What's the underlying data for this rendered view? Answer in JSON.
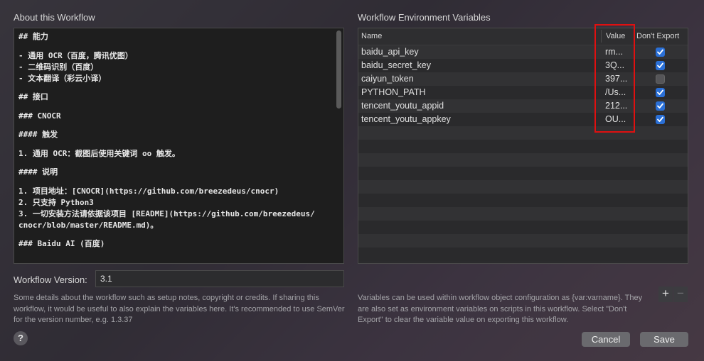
{
  "about": {
    "title": "About this Workflow",
    "notes_lines": [
      "## 能力",
      "",
      "- 通用 OCR（百度，腾讯优图）",
      "- 二维码识别（百度）",
      "- 文本翻译（彩云小译）",
      "",
      "## 接口",
      "",
      "### CNOCR",
      "",
      "#### 触发",
      "",
      "1. 通用 OCR：截图后使用关键词 oo 触发。",
      "",
      "#### 说明",
      "",
      "1. 项目地址：[CNOCR](https://github.com/breezedeus/cnocr)",
      "2. 只支持 Python3",
      "3. 一切安装方法请依据该项目 [README](https://github.com/breezedeus/",
      "cnocr/blob/master/README.md)。",
      "",
      "### Baidu AI (百度)"
    ],
    "version_label": "Workflow Version:",
    "version_value": "3.1",
    "help": "Some details about the workflow such as setup notes, copyright or credits. If sharing this workflow, it would be useful to also explain the variables here. It's recommended to use SemVer for the version number, e.g. 1.3.37"
  },
  "env": {
    "title": "Workflow Environment Variables",
    "columns": {
      "name": "Name",
      "value": "Value",
      "dont_export": "Don't Export"
    },
    "rows": [
      {
        "name": "baidu_api_key",
        "value": "rm...",
        "dont_export": true
      },
      {
        "name": "baidu_secret_key",
        "value": "3Q...",
        "dont_export": true
      },
      {
        "name": "caiyun_token",
        "value": "397...",
        "dont_export": false
      },
      {
        "name": "PYTHON_PATH",
        "value": "/Us...",
        "dont_export": true
      },
      {
        "name": "tencent_youtu_appid",
        "value": "212...",
        "dont_export": true
      },
      {
        "name": "tencent_youtu_appkey",
        "value": "OU...",
        "dont_export": true
      }
    ],
    "help": "Variables can be used within workflow object configuration as {var:varname}. They are also set as environment variables on scripts in this workflow. Select \"Don't Export\" to clear the variable value on exporting this workflow.",
    "plus": "+",
    "minus": "−"
  },
  "buttons": {
    "cancel": "Cancel",
    "save": "Save",
    "help": "?"
  },
  "colors": {
    "accent": "#2a6fd6",
    "highlight": "#e01010"
  }
}
